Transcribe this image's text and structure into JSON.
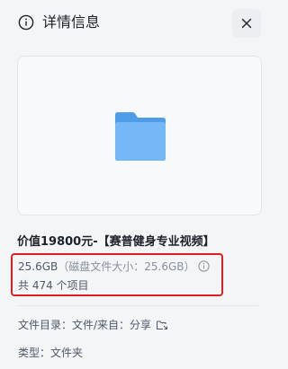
{
  "header": {
    "title": "详情信息",
    "info_icon": "info-circle-icon",
    "close_icon": "close-icon"
  },
  "preview": {
    "icon": "folder-icon",
    "folder_color": "#5aa8f0"
  },
  "details": {
    "file_name": "价值19800元-【赛普健身专业视频】",
    "size": "25.6GB",
    "disk_size": "（磁盘文件大小：25.6GB）",
    "item_count": "共 474 个项目",
    "directory_label": "文件目录：",
    "directory_value": "文件/来自：分享",
    "type_label": "类型：",
    "type_value": "文件夹"
  },
  "colors": {
    "highlight_border": "#e02020",
    "accent_folder": "#5aa8f0"
  }
}
